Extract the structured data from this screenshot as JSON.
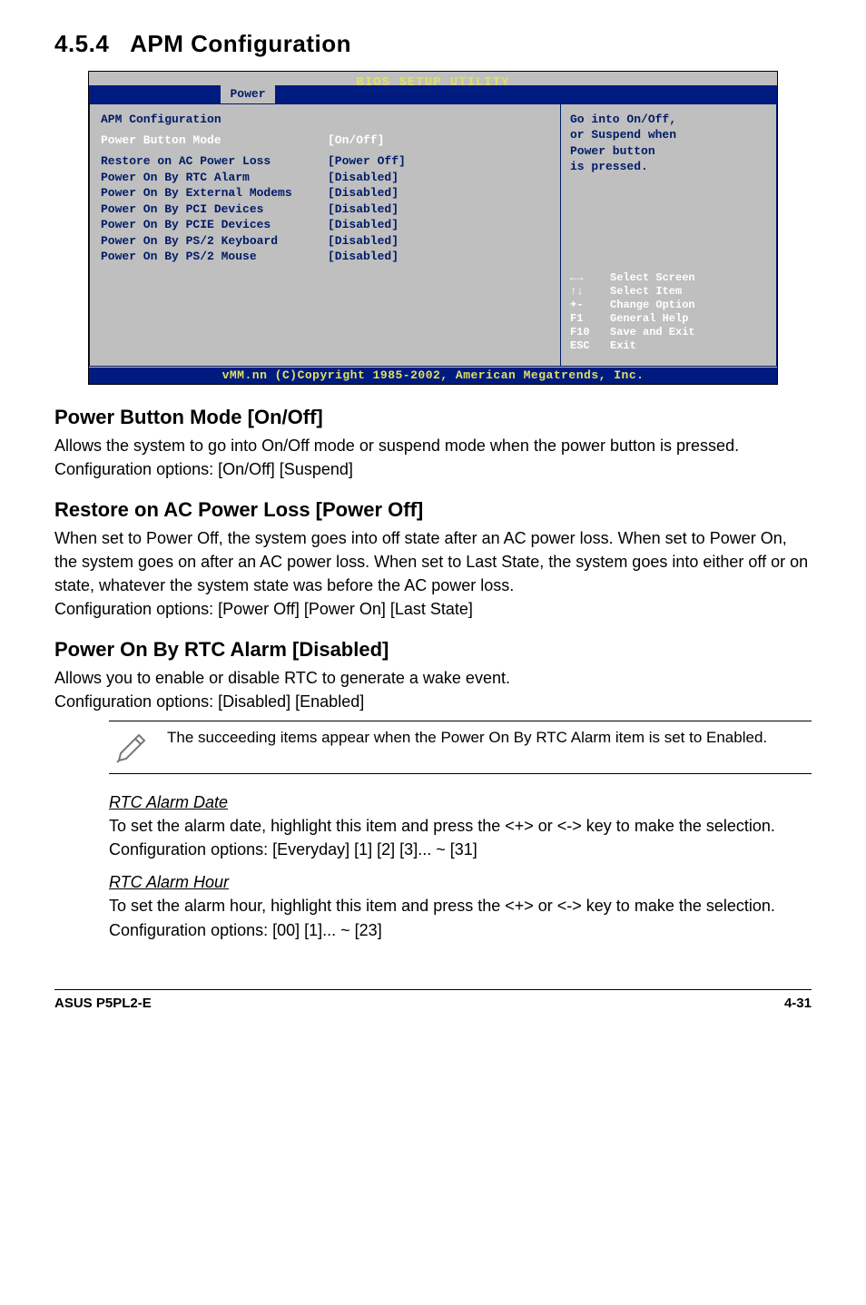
{
  "section": {
    "number": "4.5.4",
    "title": "APM Configuration"
  },
  "bios": {
    "utility_title": "BIOS SETUP UTILITY",
    "tab": "Power",
    "left_title": "APM Configuration",
    "mode": {
      "label": "Power Button Mode",
      "value": "[On/Off]"
    },
    "rows": [
      {
        "label": "Restore on AC Power Loss",
        "value": "[Power Off]"
      },
      {
        "label": "Power On By RTC Alarm",
        "value": "[Disabled]"
      },
      {
        "label": "Power On By External Modems",
        "value": "[Disabled]"
      },
      {
        "label": "Power On By PCI Devices",
        "value": "[Disabled]"
      },
      {
        "label": "Power On By PCIE Devices",
        "value": "[Disabled]"
      },
      {
        "label": "Power On By PS/2 Keyboard",
        "value": "[Disabled]"
      },
      {
        "label": "Power On By PS/2 Mouse",
        "value": "[Disabled]"
      }
    ],
    "help": "Go into On/Off,\nor Suspend when\nPower button\nis pressed.",
    "keys": [
      {
        "k": "←→",
        "v": "Select Screen"
      },
      {
        "k": "↑↓",
        "v": "Select Item"
      },
      {
        "k": "+-",
        "v": "Change Option"
      },
      {
        "k": "F1",
        "v": "General Help"
      },
      {
        "k": "F10",
        "v": "Save and Exit"
      },
      {
        "k": "ESC",
        "v": "Exit"
      }
    ],
    "footer": "vMM.nn (C)Copyright 1985-2002, American Megatrends, Inc."
  },
  "s1": {
    "title": "Power Button Mode [On/Off]",
    "body": "Allows the system to go into On/Off mode or suspend mode when the power button is pressed. Configuration options: [On/Off] [Suspend]"
  },
  "s2": {
    "title": "Restore on AC Power Loss [Power Off]",
    "body": "When set to Power Off, the system goes into off state after an AC power loss. When set to Power On, the system goes on after an AC power loss. When set to Last State, the system goes into either off or on state, whatever the system state was before the AC power loss.\nConfiguration options: [Power Off] [Power On] [Last State]"
  },
  "s3": {
    "title": "Power On By RTC Alarm [Disabled]",
    "body": "Allows you to enable or disable RTC to generate a wake event.\nConfiguration options: [Disabled] [Enabled]"
  },
  "note": "The succeeding items appear when the Power On By RTC Alarm item is set to Enabled.",
  "sub1": {
    "title": "RTC Alarm Date",
    "body": "To set the alarm date, highlight this item and press the <+> or <-> key to make the selection. Configuration options: [Everyday] [1] [2] [3]... ~ [31]"
  },
  "sub2": {
    "title": "RTC Alarm Hour",
    "body": "To set the alarm hour, highlight this item and press the <+> or <-> key to make the selection. Configuration options: [00] [1]... ~ [23]"
  },
  "footer": {
    "left": "ASUS P5PL2-E",
    "right": "4-31"
  }
}
